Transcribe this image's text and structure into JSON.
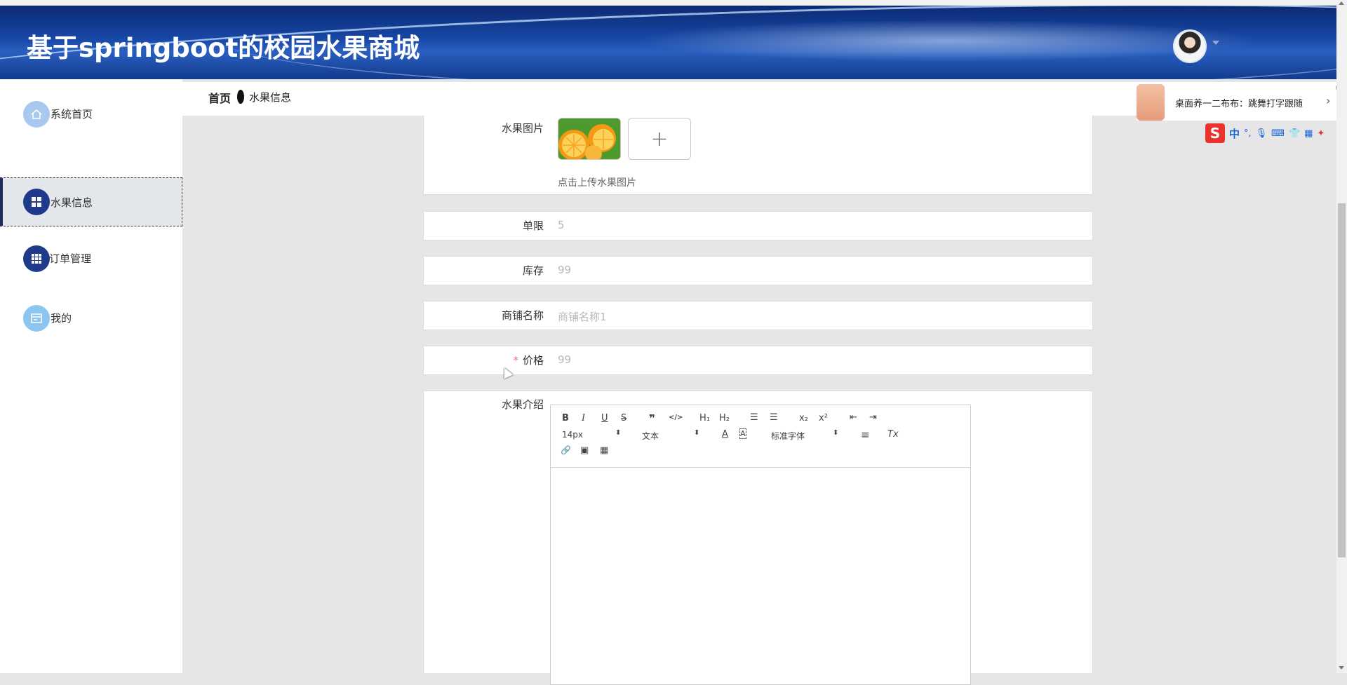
{
  "app": {
    "title": "基于springboot的校园水果商城"
  },
  "sidebar": {
    "items": [
      {
        "label": "系统首页",
        "icon": "home-icon"
      },
      {
        "label": "水果信息",
        "icon": "grid-icon",
        "active": true
      },
      {
        "label": "订单管理",
        "icon": "table-icon"
      },
      {
        "label": "我的",
        "icon": "card-icon"
      }
    ]
  },
  "breadcrumb": {
    "home": "首页",
    "current": "水果信息"
  },
  "form": {
    "image": {
      "label": "水果图片",
      "tip": "点击上传水果图片",
      "add": "+"
    },
    "limit": {
      "label": "单限",
      "value": "5"
    },
    "stock": {
      "label": "库存",
      "value": "99"
    },
    "shop": {
      "label": "商铺名称",
      "value": "商铺名称1"
    },
    "price": {
      "label": "价格",
      "value": "99",
      "required_mark": "*"
    },
    "intro": {
      "label": "水果介绍"
    }
  },
  "editor": {
    "bold": "B",
    "italic": "I",
    "underline": "U",
    "strike": "S",
    "quote": "❞",
    "code": "</>",
    "h1": "H₁",
    "h2": "H₂",
    "ol": "☰",
    "ul": "☰",
    "sub": "x₂",
    "sup": "x²",
    "outdent": "⇤",
    "indent": "⇥",
    "size": "14px",
    "header": "文本",
    "font": "标准字体",
    "color": "A",
    "bg": "A",
    "align": "≡",
    "clean": "Tx",
    "link": "🔗",
    "image": "▣",
    "video": "▦"
  },
  "popup": {
    "text": "桌面养一二布布：跳舞打字跟随",
    "arrow": "›",
    "close": "×"
  },
  "ime": {
    "logo": "S",
    "lang": "中"
  }
}
